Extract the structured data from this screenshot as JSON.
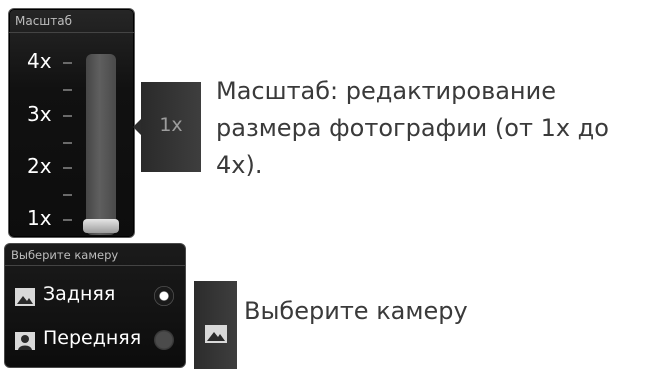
{
  "zoom_panel": {
    "title": "Масштаб",
    "levels": [
      "4x",
      "3x",
      "2x",
      "1x"
    ],
    "current_value": "1x",
    "slider_fraction": 0.0
  },
  "zoom_callout": {
    "text_line1": "Масштаб: редактирование",
    "text_line2": "размера фотографии (от 1x до",
    "text_line3": "4x)."
  },
  "camera_panel": {
    "title": "Выберите камеру",
    "options": [
      {
        "label": "Задняя",
        "icon": "landscape-icon",
        "selected": true
      },
      {
        "label": "Передняя",
        "icon": "portrait-icon",
        "selected": false
      }
    ]
  },
  "camera_callout": {
    "text": "Выберите камеру"
  }
}
